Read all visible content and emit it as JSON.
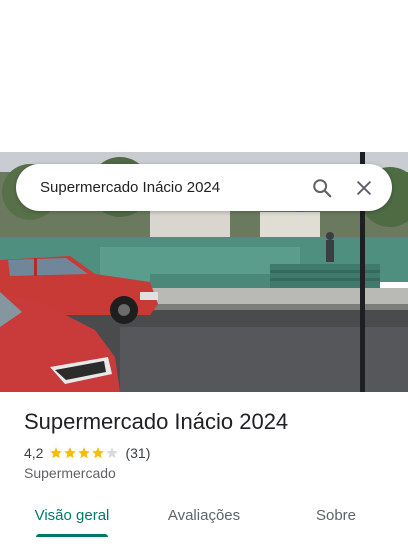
{
  "search": {
    "query": "Supermercado Inácio 2024",
    "search_icon": "search-icon",
    "close_icon": "close-icon"
  },
  "photo": {
    "description_icon": "street-view-photo"
  },
  "place": {
    "title": "Supermercado Inácio 2024",
    "rating": "4,2",
    "rating_value": 4.2,
    "review_count": "(31)",
    "category": "Supermercado"
  },
  "tabs": [
    {
      "label": "Visão geral",
      "active": true
    },
    {
      "label": "Avaliações",
      "active": false
    },
    {
      "label": "Sobre",
      "active": false
    }
  ],
  "colors": {
    "accent": "#00796b",
    "star": "#fbbc04",
    "star_empty": "#dadce0"
  }
}
